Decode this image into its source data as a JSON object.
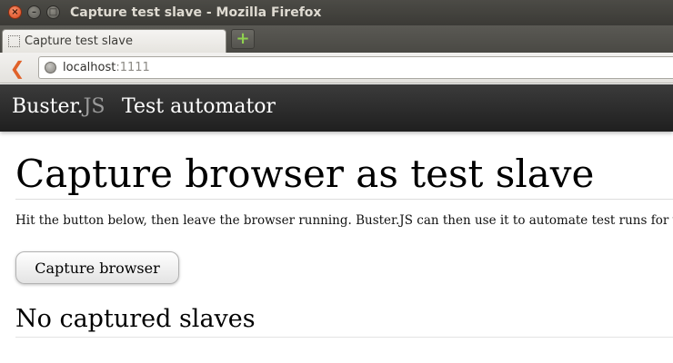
{
  "window": {
    "title": "Capture test slave - Mozilla Firefox",
    "close_glyph": "×",
    "minimize_glyph": "–",
    "maximize_glyph": "□"
  },
  "tabs": [
    {
      "label": "Capture test slave",
      "active": true
    }
  ],
  "new_tab_glyph": "+",
  "navigation": {
    "back_glyph": "❮",
    "url_host": "localhost",
    "url_port": ":1111"
  },
  "header": {
    "brand_main": "Buster.",
    "brand_js": "JS",
    "nav_link": "Test automator"
  },
  "main": {
    "title": "Capture browser as test slave",
    "intro": "Hit the button below, then leave the browser running. Buster.JS can then use it to automate test runs for you.",
    "capture_button": "Capture browser",
    "slaves_heading": "No captured slaves"
  },
  "colors": {
    "titlebar": "#3c3b37",
    "header_bar": "#2a2a2a",
    "brand_js": "#9a9a9a",
    "back_arrow": "#e0622a",
    "new_tab_plus": "#8fd14f"
  },
  "icons": [
    "close-icon",
    "minimize-icon",
    "maximize-icon",
    "page-favicon",
    "plus-icon",
    "back-arrow-icon",
    "globe-icon"
  ]
}
